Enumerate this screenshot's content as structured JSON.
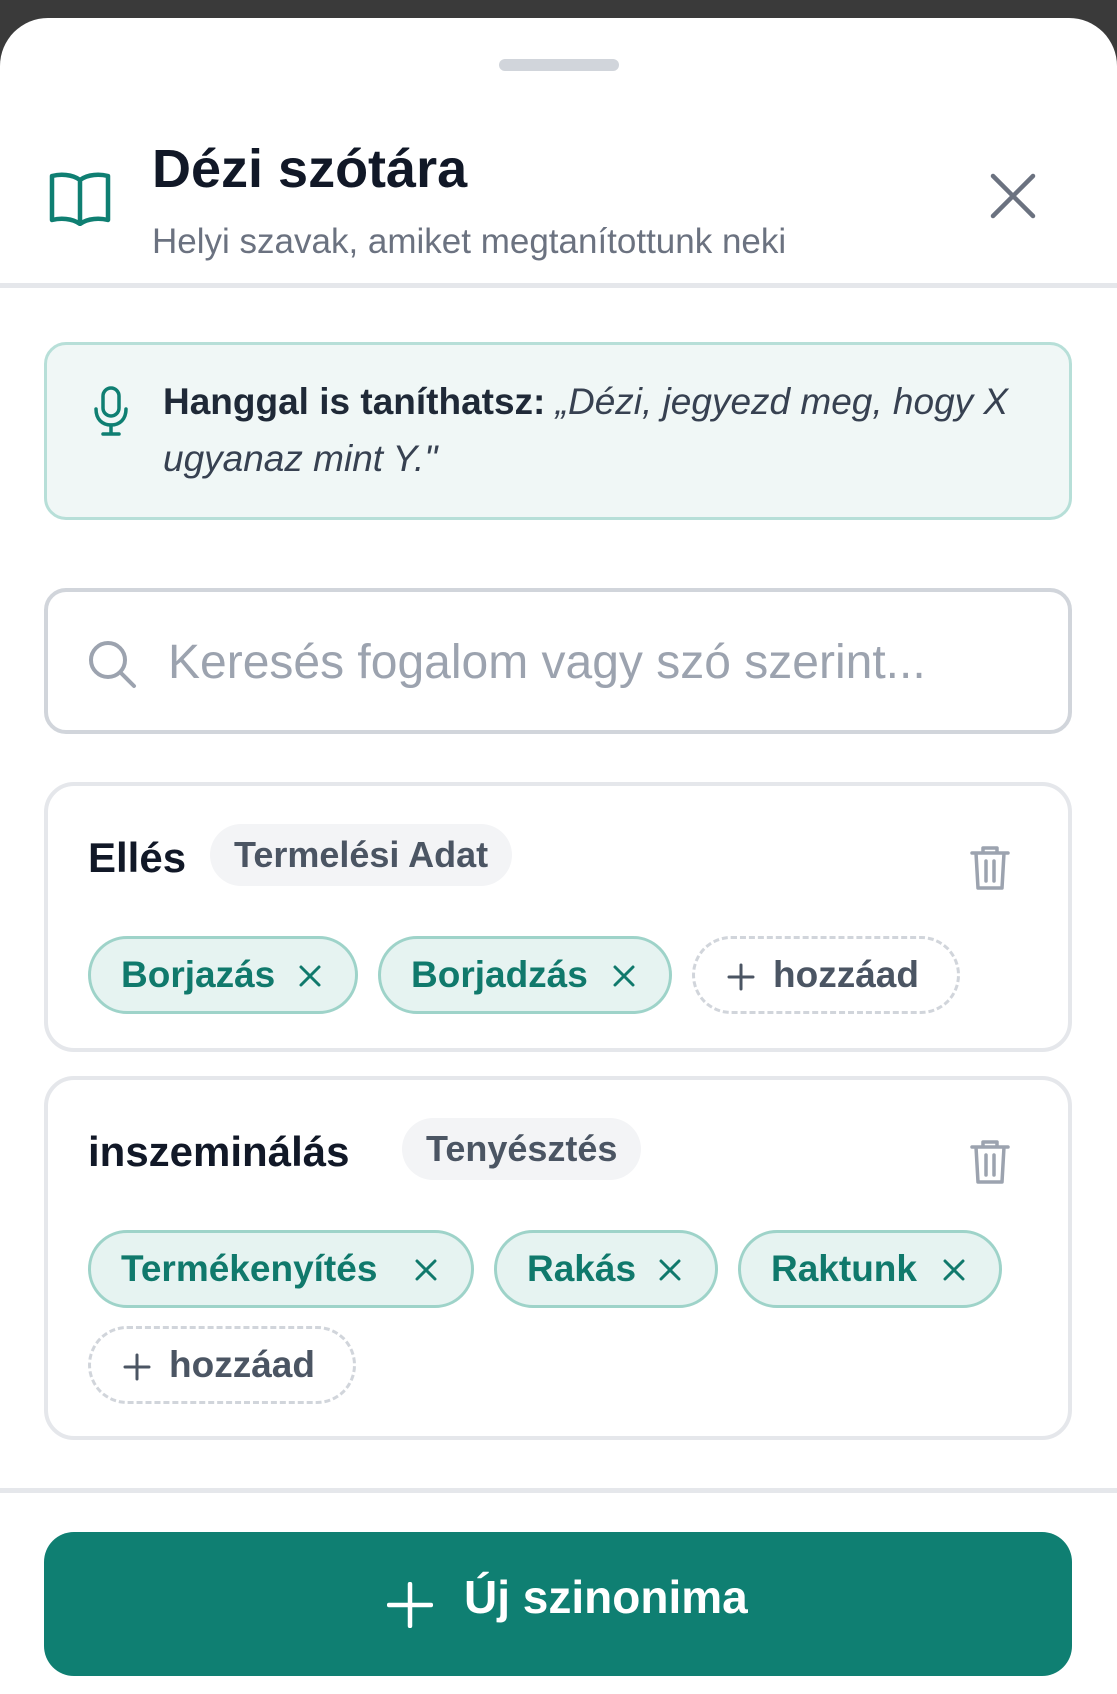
{
  "header": {
    "title": "Dézi szótára",
    "subtitle": "Helyi szavak, amiket megtanítottunk neki"
  },
  "info": {
    "bold": "Hanggal is taníthatsz:",
    "italic": "„Dézi, jegyezd meg, hogy X ugyanaz mint Y.\""
  },
  "search": {
    "placeholder": "Keresés fogalom vagy szó szerint..."
  },
  "entries": [
    {
      "term": "Ellés",
      "category": "Termelési Adat",
      "synonyms": [
        "Borjazás",
        "Borjadzás"
      ],
      "add_label": "hozzáad"
    },
    {
      "term": "inszeminálás",
      "category": "Tenyésztés",
      "synonyms": [
        "Termékenyítés",
        "Rakás",
        "Raktunk"
      ],
      "add_label": "hozzáad"
    }
  ],
  "footer": {
    "new_button": "Új szinonima"
  },
  "colors": {
    "accent": "#0f7f72",
    "chip_bg": "#e6f3f1",
    "chip_text": "#10796c",
    "info_bg": "#f0f7f6"
  }
}
